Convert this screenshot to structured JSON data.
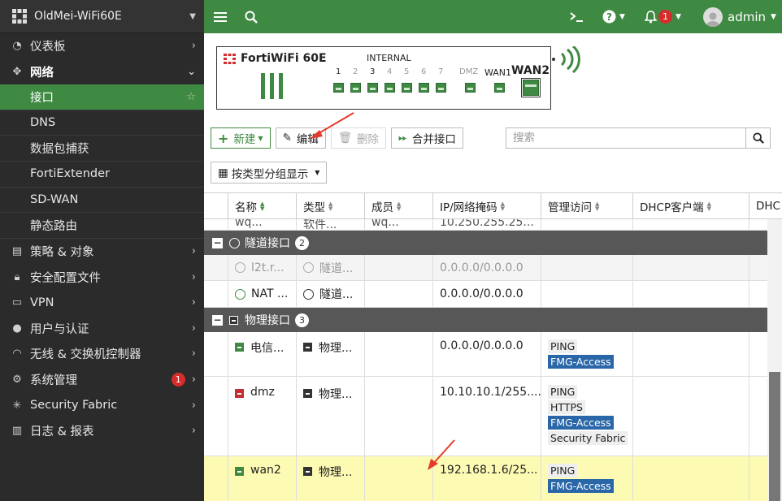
{
  "sidebar": {
    "device": "OldMei-WiFi60E",
    "items": [
      {
        "label": "仪表板"
      },
      {
        "label": "网络"
      },
      {
        "label": "接口"
      },
      {
        "label": "DNS"
      },
      {
        "label": "数据包捕获"
      },
      {
        "label": "FortiExtender"
      },
      {
        "label": "SD-WAN"
      },
      {
        "label": "静态路由"
      },
      {
        "label": "策略 & 对象"
      },
      {
        "label": "安全配置文件"
      },
      {
        "label": "VPN"
      },
      {
        "label": "用户与认证"
      },
      {
        "label": "无线 & 交换机控制器"
      },
      {
        "label": "系统管理",
        "badge": "1"
      },
      {
        "label": "Security Fabric"
      },
      {
        "label": "日志 & 报表"
      }
    ]
  },
  "topbar": {
    "notify_count": "1",
    "user": "admin"
  },
  "device_panel": {
    "model": "FortiWiFi 60E",
    "internal_label": "INTERNAL",
    "ports": [
      "1",
      "2",
      "3",
      "4",
      "5",
      "6",
      "7"
    ],
    "dmz": "DMZ",
    "wan1": "WAN1",
    "wan2": "WAN2"
  },
  "toolbar": {
    "new": "新建",
    "edit": "编辑",
    "delete": "删除",
    "merge": "合并接口",
    "search_placeholder": "搜索",
    "groupby": "按类型分组显示"
  },
  "table": {
    "headers": [
      "名称",
      "类型",
      "成员",
      "IP/网络掩码",
      "管理访问",
      "DHCP客户端",
      "DHC"
    ],
    "partial_row": {
      "name": "wq...",
      "type": "软件...",
      "member": "wq...",
      "ip": "10.250.255.25..."
    },
    "groups": [
      {
        "title": "隧道接口",
        "count": "2",
        "rows": [
          {
            "name": "l2t.r...",
            "type": "隧道...",
            "ip": "0.0.0.0/0.0.0.0",
            "disabled": true
          },
          {
            "name": "NAT ...",
            "type": "隧道...",
            "ip": "0.0.0.0/0.0.0.0"
          }
        ]
      },
      {
        "title": "物理接口",
        "count": "3",
        "rows": [
          {
            "name": "电信...",
            "type": "物理...",
            "ip": "0.0.0.0/0.0.0.0",
            "access": [
              "PING",
              "FMG-Access"
            ]
          },
          {
            "name": "dmz",
            "type": "物理...",
            "ip": "10.10.10.1/255....",
            "access": [
              "PING",
              "HTTPS",
              "FMG-Access",
              "Security Fabric"
            ]
          },
          {
            "name": "wan2",
            "type": "物理...",
            "ip": "192.168.1.6/25...",
            "access": [
              "PING",
              "FMG-Access"
            ]
          }
        ]
      }
    ]
  },
  "colors": {
    "brand_green": "#3f8a43",
    "sidebar_bg": "#2b2b2b",
    "highlight_row": "#fdfbb3",
    "pill_blue": "#2a67a8"
  }
}
